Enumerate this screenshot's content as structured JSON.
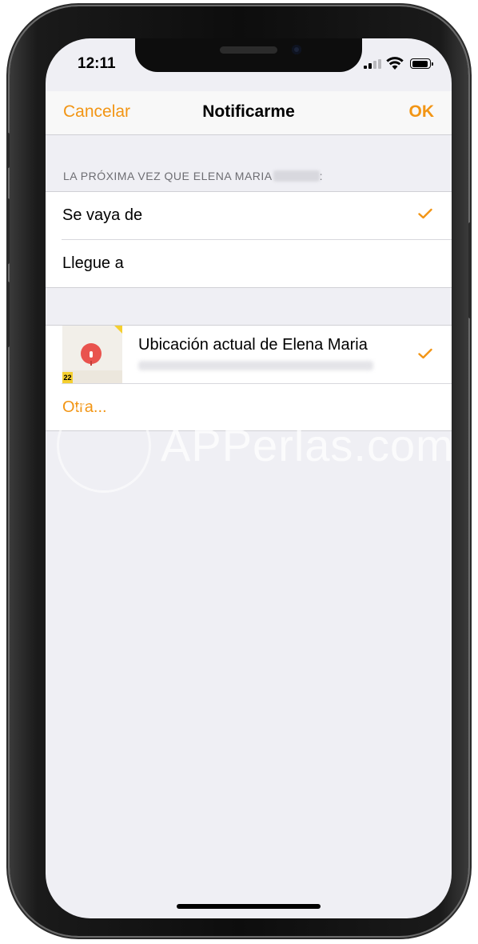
{
  "status_bar": {
    "time": "12:11"
  },
  "nav": {
    "cancel_label": "Cancelar",
    "title": "Notificarme",
    "ok_label": "OK"
  },
  "section_header": "LA PRÓXIMA VEZ QUE ELENA MARIA",
  "section_header_suffix": ":",
  "trigger_options": [
    {
      "label": "Se vaya de",
      "selected": true
    },
    {
      "label": "Llegue a",
      "selected": false
    }
  ],
  "location": {
    "title": "Ubicación actual de Elena Maria",
    "selected": true,
    "map_badge": "22"
  },
  "other_label": "Otra...",
  "watermark": "APPerlas.com",
  "colors": {
    "accent": "#f29514",
    "background": "#efeff4",
    "pin": "#e9534e"
  }
}
